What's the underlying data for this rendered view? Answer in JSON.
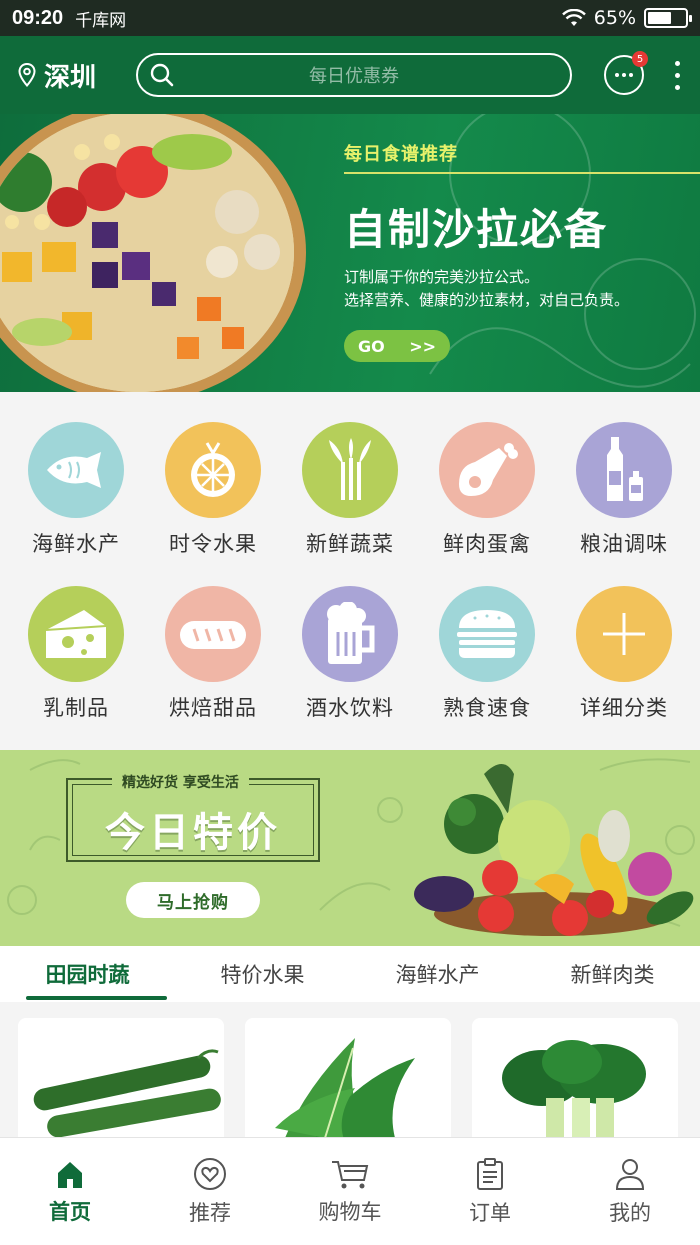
{
  "status_bar": {
    "time": "09:20",
    "carrier": "千库网",
    "battery": "65%",
    "battery_level": 0.65
  },
  "header": {
    "city": "深圳",
    "search_placeholder": "每日优惠券",
    "message_badge": "5"
  },
  "hero": {
    "kicker": "每日食谱推荐",
    "title": "自制沙拉必备",
    "desc_line1": "订制属于你的完美沙拉公式。",
    "desc_line2": "选择营养、健康的沙拉素材，对自己负责。",
    "go_label": "GO",
    "go_arrow": ">>"
  },
  "categories": [
    {
      "label": "海鲜水产",
      "icon": "fish-icon",
      "color": "#9fd6d8"
    },
    {
      "label": "时令水果",
      "icon": "orange-icon",
      "color": "#f2c25a"
    },
    {
      "label": "新鲜蔬菜",
      "icon": "vegetable-icon",
      "color": "#b5cf5a"
    },
    {
      "label": "鲜肉蛋禽",
      "icon": "ham-icon",
      "color": "#f0b6a6"
    },
    {
      "label": "粮油调味",
      "icon": "bottle-icon",
      "color": "#a9a4d6"
    },
    {
      "label": "乳制品",
      "icon": "cheese-icon",
      "color": "#b5cf5a"
    },
    {
      "label": "烘焙甜品",
      "icon": "bread-icon",
      "color": "#f0b6a6"
    },
    {
      "label": "酒水饮料",
      "icon": "beer-icon",
      "color": "#a9a4d6"
    },
    {
      "label": "熟食速食",
      "icon": "burger-icon",
      "color": "#9fd6d8"
    },
    {
      "label": "详细分类",
      "icon": "plus-icon",
      "color": "#f2c25a"
    }
  ],
  "promo": {
    "tag": "精选好货 享受生活",
    "title": "今日特价",
    "button": "马上抢购"
  },
  "tabs": [
    "田园时蔬",
    "特价水果",
    "海鲜水产",
    "新鲜肉类"
  ],
  "products": [
    {
      "name": "cucumber"
    },
    {
      "name": "lettuce"
    },
    {
      "name": "bok-choy"
    }
  ],
  "nav": [
    {
      "label": "首页",
      "icon": "home-icon"
    },
    {
      "label": "推荐",
      "icon": "heart-icon"
    },
    {
      "label": "购物车",
      "icon": "cart-icon"
    },
    {
      "label": "订单",
      "icon": "clipboard-icon"
    },
    {
      "label": "我的",
      "icon": "user-icon"
    }
  ],
  "colors": {
    "brand_green": "#0f6b3a",
    "accent_yellow": "#e8f26b",
    "promo_bg": "#b9da84"
  }
}
